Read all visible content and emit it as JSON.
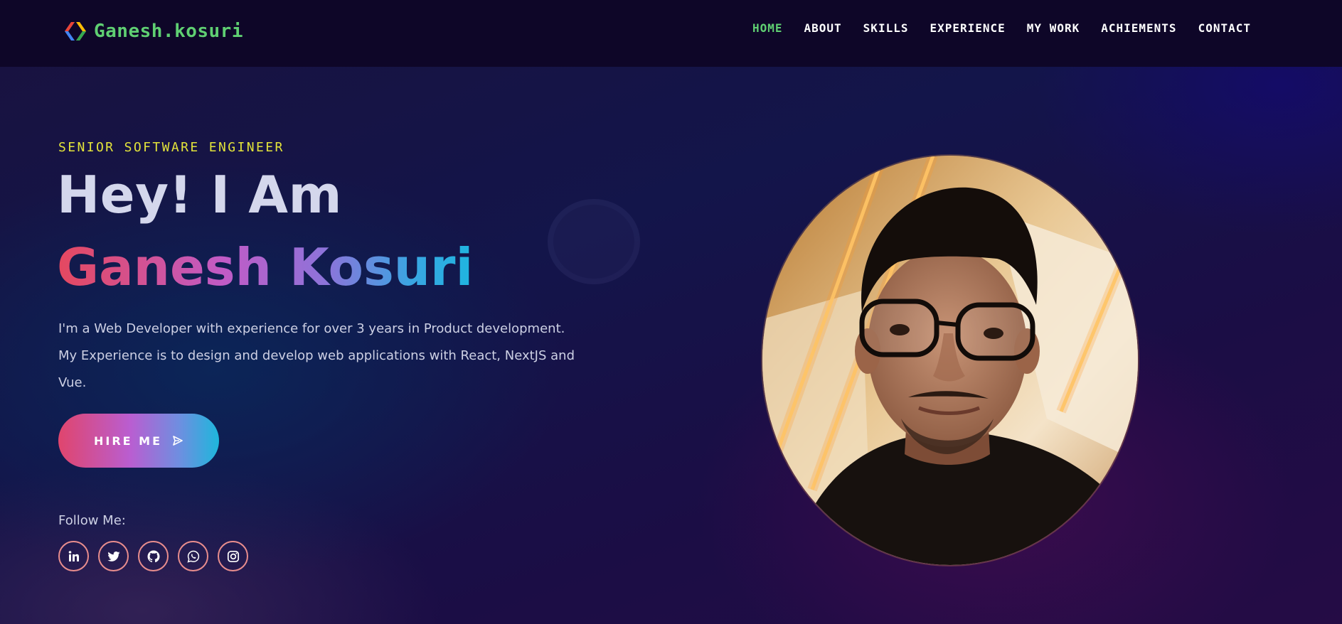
{
  "brand": {
    "name": "Ganesh.kosuri",
    "logo_icon": "code-brackets-icon",
    "logo_colors": [
      "#4285f4",
      "#ea4335",
      "#fbbc05",
      "#34a853"
    ]
  },
  "nav": {
    "items": [
      {
        "label": "HOME",
        "active": true
      },
      {
        "label": "ABOUT",
        "active": false
      },
      {
        "label": "SKILLS",
        "active": false
      },
      {
        "label": "EXPERIENCE",
        "active": false
      },
      {
        "label": "MY WORK",
        "active": false
      },
      {
        "label": "ACHIEMENTS",
        "active": false
      },
      {
        "label": "CONTACT",
        "active": false
      }
    ]
  },
  "hero": {
    "eyebrow": "SENIOR SOFTWARE ENGINEER",
    "greeting": "Hey! I Am",
    "name": "Ganesh Kosuri",
    "intro": "I'm a Web Developer with experience for over 3 years in Product development. My Experience is to design and develop web applications with React, NextJS and Vue.",
    "cta_label": "HIRE ME",
    "cta_icon": "send-icon",
    "follow_label": "Follow Me:",
    "socials": [
      "linkedin-icon",
      "twitter-icon",
      "github-icon",
      "whatsapp-icon",
      "instagram-icon"
    ]
  },
  "colors": {
    "accent_green": "#5fcf72",
    "eyebrow_yellow": "#e3e43a",
    "name_gradient": [
      "#e5485f",
      "#c15bc6",
      "#8c74da",
      "#1fb5e0"
    ],
    "social_border": "#e88d8d"
  }
}
